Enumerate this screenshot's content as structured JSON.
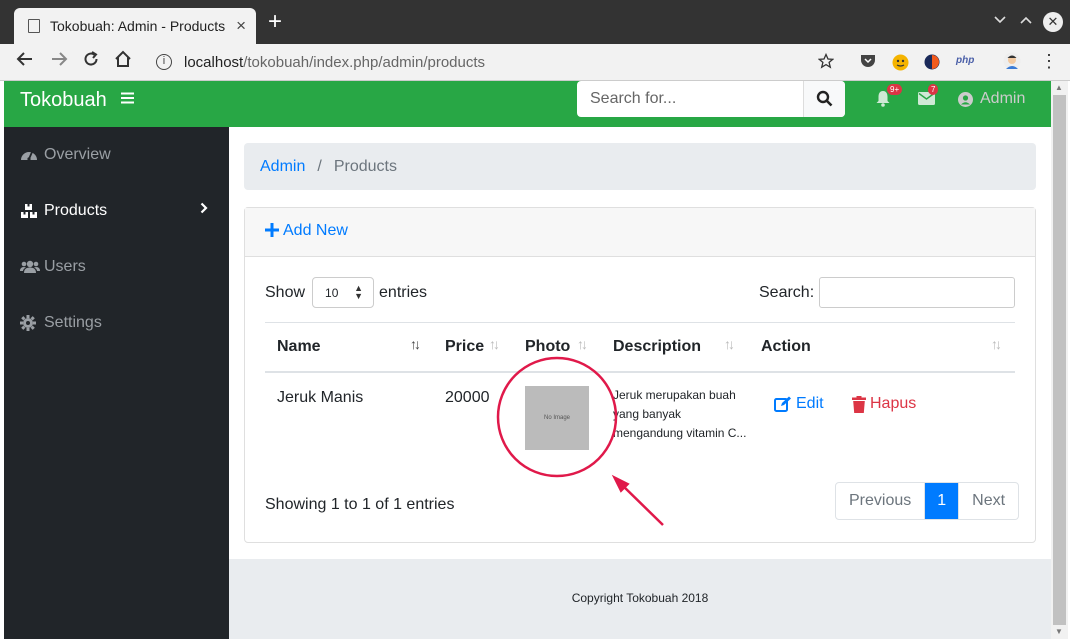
{
  "browser": {
    "tab_title": "Tokobuah: Admin - Products",
    "tab_close": "×",
    "new_tab": "+",
    "url_host": "localhost",
    "url_path": "/tokobuah/index.php/admin/products",
    "ext_php": "php"
  },
  "navbar": {
    "brand": "Tokobuah",
    "search_placeholder": "Search for...",
    "alerts_badge": "9+",
    "messages_badge": "7",
    "user_label": "Admin",
    "bg_color": "#28a745"
  },
  "sidebar": {
    "items": [
      {
        "label": "Overview",
        "icon": "tachometer-icon"
      },
      {
        "label": "Products",
        "icon": "boxes-icon",
        "active": true
      },
      {
        "label": "Users",
        "icon": "users-icon"
      },
      {
        "label": "Settings",
        "icon": "cog-icon"
      }
    ]
  },
  "breadcrumb": {
    "link": "Admin",
    "sep": "/",
    "current": "Products"
  },
  "card": {
    "add_new": "Add New",
    "show_label": "Show",
    "entries_label": "entries",
    "length_value": "10",
    "search_label": "Search:"
  },
  "table": {
    "headers": [
      "Name",
      "Price",
      "Photo",
      "Description",
      "Action"
    ],
    "rows": [
      {
        "name": "Jeruk Manis",
        "price": "20000",
        "photo_text": "No Image",
        "description": "Jeruk merupakan buah yang banyak mengandung vitamin C...",
        "edit_label": "Edit",
        "delete_label": "Hapus"
      }
    ]
  },
  "pagination": {
    "info": "Showing 1 to 1 of 1 entries",
    "previous": "Previous",
    "page": "1",
    "next": "Next"
  },
  "footer": {
    "copyright": "Copyright Tokobuah 2018"
  },
  "colors": {
    "primary": "#007bff",
    "danger": "#dc3545",
    "sidebar": "#212529",
    "annotation": "#e0194a"
  }
}
